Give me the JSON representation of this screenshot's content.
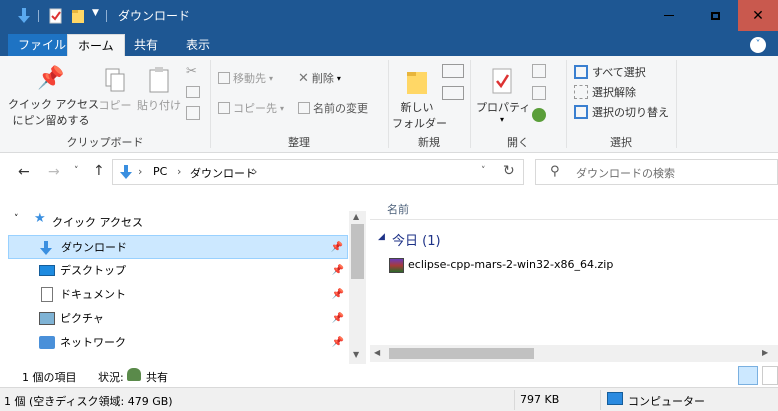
{
  "window": {
    "title": "ダウンロード"
  },
  "ribbon_tabs": [
    "ファイル",
    "ホーム",
    "共有",
    "表示"
  ],
  "clipboard": {
    "pin_label_1": "クイック アクセス",
    "pin_label_2": "にピン留めする",
    "copy": "コピー",
    "paste": "貼り付け",
    "group": "クリップボード"
  },
  "organize": {
    "move_to": "移動先",
    "copy_to": "コピー先",
    "delete": "削除",
    "rename": "名前の変更",
    "group": "整理"
  },
  "new": {
    "new_folder_1": "新しい",
    "new_folder_2": "フォルダー",
    "group": "新規"
  },
  "open": {
    "properties": "プロパティ",
    "group": "開く"
  },
  "select": {
    "select_all": "すべて選択",
    "select_none": "選択解除",
    "invert": "選択の切り替え",
    "group": "選択"
  },
  "address": {
    "crumbs": [
      "PC",
      "ダウンロード"
    ],
    "search_placeholder": "ダウンロードの検索"
  },
  "navpane": {
    "quick_access": "クイック アクセス",
    "items": [
      "ダウンロード",
      "デスクトップ",
      "ドキュメント",
      "ピクチャ",
      "ネットワーク"
    ]
  },
  "content": {
    "column_name": "名前",
    "group_label": "今日 (1)",
    "files": [
      "eclipse-cpp-mars-2-win32-x86_64.zip"
    ]
  },
  "status": {
    "item_count": "1 個の項目",
    "state_label": "状況:",
    "state_value": "共有"
  },
  "bottom_status": {
    "free_space": "1 個 (空きディスク領域: 479 GB)",
    "size": "797 KB",
    "location": "コンピューター"
  },
  "colors": {
    "titlebar": "#1e5793",
    "accent": "#1e73c3",
    "close": "#c9594e",
    "selection": "#cce8ff"
  }
}
